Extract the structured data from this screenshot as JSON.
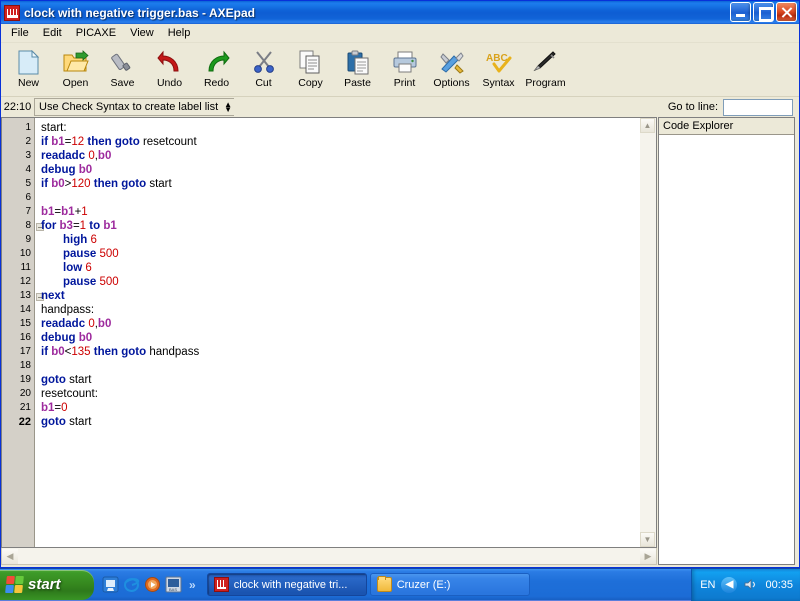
{
  "window": {
    "title": "clock with negative trigger.bas - AXEpad",
    "app_icon": "axepad-icon",
    "buttons": {
      "minimize": "minimize-icon",
      "maximize": "restore-icon",
      "close": "close-icon"
    }
  },
  "menu": {
    "items": [
      {
        "label": "File"
      },
      {
        "label": "Edit"
      },
      {
        "label": "PICAXE"
      },
      {
        "label": "View"
      },
      {
        "label": "Help"
      }
    ]
  },
  "toolbar": {
    "buttons": [
      {
        "label": "New",
        "icon": "new-document-icon"
      },
      {
        "label": "Open",
        "icon": "open-folder-icon"
      },
      {
        "label": "Save",
        "icon": "save-usb-icon"
      },
      {
        "label": "Undo",
        "icon": "undo-arrow-icon"
      },
      {
        "label": "Redo",
        "icon": "redo-arrow-icon"
      },
      {
        "label": "Cut",
        "icon": "scissors-icon"
      },
      {
        "label": "Copy",
        "icon": "copy-pages-icon"
      },
      {
        "label": "Paste",
        "icon": "clipboard-icon"
      },
      {
        "label": "Print",
        "icon": "printer-icon"
      },
      {
        "label": "Options",
        "icon": "tools-icon"
      },
      {
        "label": "Syntax",
        "icon": "abc-check-icon"
      },
      {
        "label": "Program",
        "icon": "pen-icon"
      }
    ]
  },
  "info_bar": {
    "caret_position": "22:10",
    "label_list": {
      "value": "Use Check Syntax to create label list",
      "icon": "spinner-updown-icon"
    },
    "goto_line": {
      "label": "Go to line:",
      "value": "",
      "placeholder": ""
    }
  },
  "editor": {
    "current_line": 22,
    "fold_lines": [
      8,
      13
    ],
    "lines": [
      {
        "n": 1,
        "indent": 0,
        "tokens": [
          {
            "t": "start:",
            "c": "plain"
          }
        ]
      },
      {
        "n": 2,
        "indent": 0,
        "tokens": [
          {
            "t": "if ",
            "c": "kw"
          },
          {
            "t": "b1",
            "c": "var"
          },
          {
            "t": "=",
            "c": "plain"
          },
          {
            "t": "12",
            "c": "num"
          },
          {
            "t": " then goto ",
            "c": "kw"
          },
          {
            "t": "resetcount",
            "c": "plain"
          }
        ]
      },
      {
        "n": 3,
        "indent": 0,
        "tokens": [
          {
            "t": "readadc ",
            "c": "kw"
          },
          {
            "t": "0",
            "c": "num"
          },
          {
            "t": ",",
            "c": "plain"
          },
          {
            "t": "b0",
            "c": "var"
          }
        ]
      },
      {
        "n": 4,
        "indent": 0,
        "tokens": [
          {
            "t": "debug ",
            "c": "kw"
          },
          {
            "t": "b0",
            "c": "var"
          }
        ]
      },
      {
        "n": 5,
        "indent": 0,
        "tokens": [
          {
            "t": "if ",
            "c": "kw"
          },
          {
            "t": "b0",
            "c": "var"
          },
          {
            "t": ">",
            "c": "plain"
          },
          {
            "t": "120",
            "c": "num"
          },
          {
            "t": " then goto ",
            "c": "kw"
          },
          {
            "t": "start",
            "c": "plain"
          }
        ]
      },
      {
        "n": 6,
        "indent": 0,
        "tokens": []
      },
      {
        "n": 7,
        "indent": 0,
        "tokens": [
          {
            "t": "b1",
            "c": "var"
          },
          {
            "t": "=",
            "c": "plain"
          },
          {
            "t": "b1",
            "c": "var"
          },
          {
            "t": "+",
            "c": "plain"
          },
          {
            "t": "1",
            "c": "num"
          }
        ]
      },
      {
        "n": 8,
        "indent": 0,
        "tokens": [
          {
            "t": "for ",
            "c": "kw"
          },
          {
            "t": "b3",
            "c": "var"
          },
          {
            "t": "=",
            "c": "plain"
          },
          {
            "t": "1",
            "c": "num"
          },
          {
            "t": " to ",
            "c": "kw"
          },
          {
            "t": "b1",
            "c": "var"
          }
        ]
      },
      {
        "n": 9,
        "indent": 1,
        "tokens": [
          {
            "t": "high ",
            "c": "kw"
          },
          {
            "t": "6",
            "c": "num"
          }
        ]
      },
      {
        "n": 10,
        "indent": 1,
        "tokens": [
          {
            "t": "pause ",
            "c": "kw"
          },
          {
            "t": "500",
            "c": "num"
          }
        ]
      },
      {
        "n": 11,
        "indent": 1,
        "tokens": [
          {
            "t": "low ",
            "c": "kw"
          },
          {
            "t": "6",
            "c": "num"
          }
        ]
      },
      {
        "n": 12,
        "indent": 1,
        "tokens": [
          {
            "t": "pause ",
            "c": "kw"
          },
          {
            "t": "500",
            "c": "num"
          }
        ]
      },
      {
        "n": 13,
        "indent": 0,
        "tokens": [
          {
            "t": "next",
            "c": "kw"
          }
        ]
      },
      {
        "n": 14,
        "indent": 0,
        "tokens": [
          {
            "t": "handpass:",
            "c": "plain"
          }
        ]
      },
      {
        "n": 15,
        "indent": 0,
        "tokens": [
          {
            "t": "readadc ",
            "c": "kw"
          },
          {
            "t": "0",
            "c": "num"
          },
          {
            "t": ",",
            "c": "plain"
          },
          {
            "t": "b0",
            "c": "var"
          }
        ]
      },
      {
        "n": 16,
        "indent": 0,
        "tokens": [
          {
            "t": "debug ",
            "c": "kw"
          },
          {
            "t": "b0",
            "c": "var"
          }
        ]
      },
      {
        "n": 17,
        "indent": 0,
        "tokens": [
          {
            "t": "if ",
            "c": "kw"
          },
          {
            "t": "b0",
            "c": "var"
          },
          {
            "t": "<",
            "c": "plain"
          },
          {
            "t": "135",
            "c": "num"
          },
          {
            "t": " then goto ",
            "c": "kw"
          },
          {
            "t": "handpass",
            "c": "plain"
          }
        ]
      },
      {
        "n": 18,
        "indent": 0,
        "tokens": []
      },
      {
        "n": 19,
        "indent": 0,
        "tokens": [
          {
            "t": "goto ",
            "c": "kw"
          },
          {
            "t": "start",
            "c": "plain"
          }
        ]
      },
      {
        "n": 20,
        "indent": 0,
        "tokens": [
          {
            "t": "resetcount:",
            "c": "plain"
          }
        ]
      },
      {
        "n": 21,
        "indent": 0,
        "tokens": [
          {
            "t": "b1",
            "c": "var"
          },
          {
            "t": "=",
            "c": "plain"
          },
          {
            "t": "0",
            "c": "num"
          }
        ]
      },
      {
        "n": 22,
        "indent": 0,
        "tokens": [
          {
            "t": "goto ",
            "c": "kw"
          },
          {
            "t": "start",
            "c": "plain"
          }
        ]
      }
    ],
    "scrollbar": {
      "up_arrow": "scroll-up-icon",
      "down_arrow": "scroll-down-icon",
      "left_arrow": "scroll-left-icon",
      "right_arrow": "scroll-right-icon"
    }
  },
  "code_explorer": {
    "header": "Code Explorer",
    "items": []
  },
  "taskbar": {
    "start_label": "start",
    "quick_launch": [
      {
        "icon": "show-desktop-icon"
      },
      {
        "icon": "internet-explorer-icon"
      },
      {
        "icon": "media-player-icon"
      },
      {
        "icon": "picaxe-editor-icon"
      }
    ],
    "overflow_label": "»",
    "tasks": [
      {
        "label": "clock with negative tri...",
        "icon": "axepad-icon",
        "active": true
      },
      {
        "label": "Cruzer (E:)",
        "icon": "folder-icon",
        "active": false
      }
    ],
    "tray": {
      "language": "EN",
      "chevron": "show-hidden-icons-icon",
      "volume": "volume-icon",
      "clock": "00:35"
    }
  },
  "colors": {
    "keyword": "#00169c",
    "variable": "#9d2a9d",
    "number": "#cc0000",
    "title_bar": "#0f63d8",
    "taskbar": "#1e6fd9",
    "start_button": "#36891f"
  }
}
